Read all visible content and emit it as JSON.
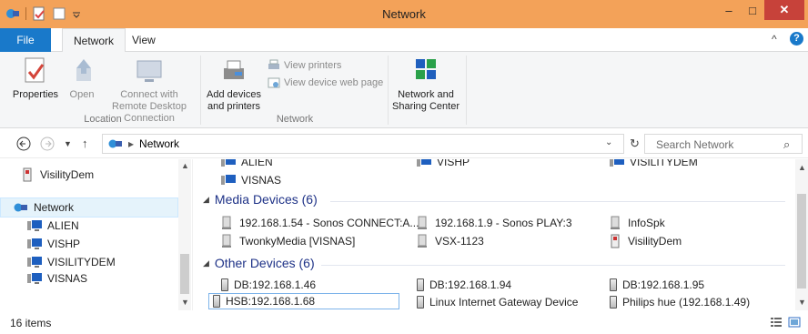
{
  "window": {
    "title": "Network"
  },
  "titlebar": {
    "minimize": "–",
    "maximize": "□",
    "close": "✕"
  },
  "ribbon_tabs": [
    {
      "label": "File"
    },
    {
      "label": "Network"
    },
    {
      "label": "View"
    }
  ],
  "ribbon_controls": {
    "collapse": "^",
    "help": "?"
  },
  "ribbon": {
    "location_group": {
      "label": "Location",
      "buttons": [
        {
          "label": "Properties"
        },
        {
          "label": "Open"
        },
        {
          "label": "Connect with Remote Desktop Connection"
        }
      ]
    },
    "network_group": {
      "label": "Network",
      "buttons": [
        {
          "label": "Add devices and printers"
        },
        {
          "label": "View printers"
        },
        {
          "label": "View device web page"
        }
      ]
    },
    "sharing_group": {
      "buttons": [
        {
          "label": "Network and Sharing Center"
        }
      ]
    }
  },
  "address": {
    "crumb": "Network",
    "search_placeholder": "Search Network"
  },
  "nav": {
    "items": [
      {
        "label": "VisilityDem",
        "icon": "media-device-icon"
      },
      {
        "label": "Network",
        "icon": "network-icon",
        "selected": true
      },
      {
        "label": "ALIEN",
        "icon": "computer-icon"
      },
      {
        "label": "VISHP",
        "icon": "computer-icon"
      },
      {
        "label": "VISILITYDEM",
        "icon": "computer-icon"
      },
      {
        "label": "VISNAS",
        "icon": "computer-icon"
      }
    ]
  },
  "content": {
    "computers_partial": [
      "ALIEN",
      "VISHP",
      "VISILITYDEM",
      "VISNAS"
    ],
    "media_group": {
      "heading": "Media Devices (6)",
      "items": [
        "192.168.1.54 - Sonos CONNECT:A...",
        "192.168.1.9 - Sonos PLAY:3",
        "InfoSpk",
        "TwonkyMedia [VISNAS]",
        "VSX-1123",
        "VisilityDem"
      ]
    },
    "other_group": {
      "heading": "Other Devices (6)",
      "items": [
        "DB:192.168.1.46",
        "DB:192.168.1.94",
        "DB:192.168.1.95",
        "HSB:192.168.1.68",
        "Linux Internet Gateway Device",
        "Philips hue (192.168.1.49)"
      ]
    }
  },
  "status": {
    "count": "16 items"
  },
  "colors": {
    "titlebar": "#f3a259",
    "file_tab": "#1979ca",
    "group_heading": "#1e3287",
    "close_button": "#c7423a"
  }
}
